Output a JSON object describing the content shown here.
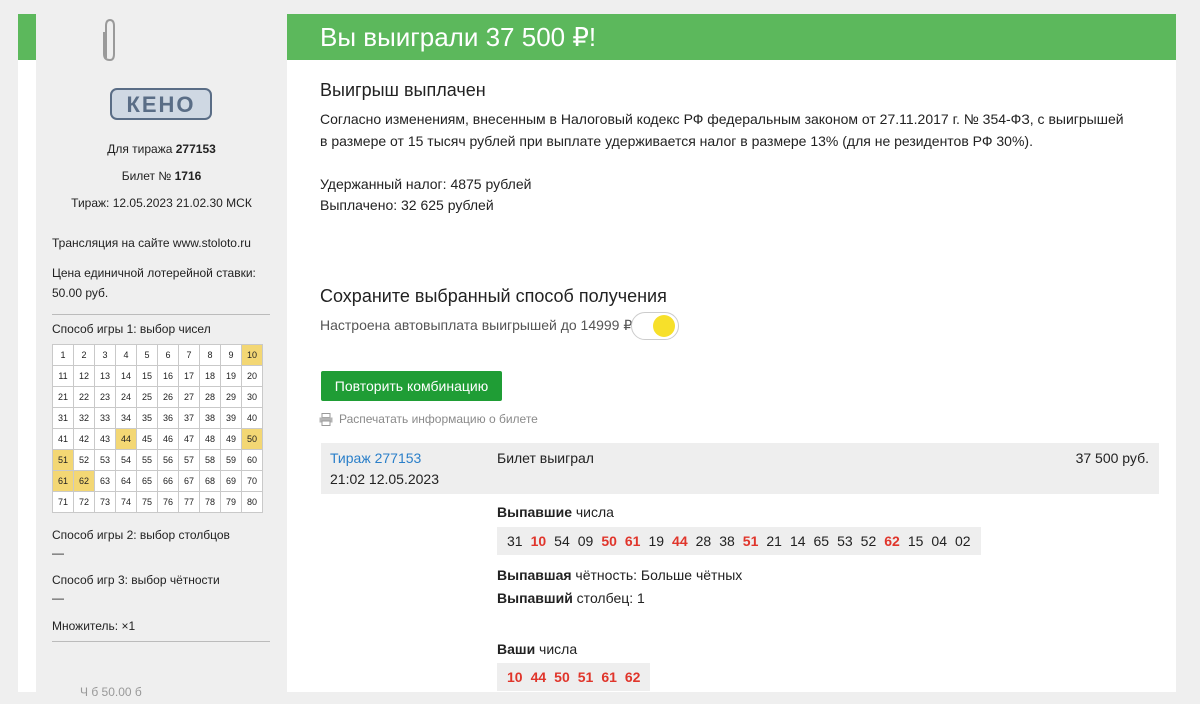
{
  "ticket": {
    "logo_text": "КЕНО",
    "draw_label": "Для тиража",
    "draw_number": "277153",
    "ticket_label": "Билет №",
    "ticket_number": "1716",
    "draw_datetime": "Тираж: 12.05.2023 21.02.30 МСК",
    "broadcast": "Трансляция на сайте www.stoloto.ru",
    "price_label": "Цена единичной лотерейной ставки:",
    "price_value": "50.00 руб.",
    "game1": "Способ игры 1: выбор чисел",
    "grid_numbers": [
      1,
      2,
      3,
      4,
      5,
      6,
      7,
      8,
      9,
      10,
      11,
      12,
      13,
      14,
      15,
      16,
      17,
      18,
      19,
      20,
      21,
      22,
      23,
      24,
      25,
      26,
      27,
      28,
      29,
      30,
      31,
      32,
      33,
      34,
      35,
      36,
      37,
      38,
      39,
      40,
      41,
      42,
      43,
      44,
      45,
      46,
      47,
      48,
      49,
      50,
      51,
      52,
      53,
      54,
      55,
      56,
      57,
      58,
      59,
      60,
      61,
      62,
      63,
      64,
      65,
      66,
      67,
      68,
      69,
      70,
      71,
      72,
      73,
      74,
      75,
      76,
      77,
      78,
      79,
      80
    ],
    "selected_numbers": [
      10,
      44,
      50,
      51,
      61,
      62
    ],
    "game2": "Способ игры 2: выбор столбцов",
    "game2_value": "—",
    "game3": "Способ игр 3: выбор чётности",
    "game3_value": "—",
    "multiplier": "Множитель: ×1",
    "bottom_cut": "Ч   б         50.00   б"
  },
  "banner": {
    "title": "Вы выиграли 37 500 ₽!",
    "color": "#5cb85c"
  },
  "payout": {
    "heading": "Выигрыш выплачен",
    "tax_text_1": "Согласно изменениям, внесенным в Налоговый кодекс РФ федеральным законом от 27.11.2017 г. № 354-ФЗ, с выигрышей",
    "tax_text_2": "в размере от 15 тысяч рублей при выплате удерживается налог в размере 13% (для не резидентов РФ 30%).",
    "tax_withheld": "Удержанный налог: 4875 рублей",
    "paid_out": "Выплачено: 32 625 рублей"
  },
  "receive": {
    "heading": "Сохраните выбранный способ получения",
    "autopay_label": "Настроена автовыплата выигрышей до 14999 ₽",
    "autopay_on": true
  },
  "actions": {
    "repeat_button": "Повторить комбинацию",
    "print_link": "Распечатать информацию о билете"
  },
  "result": {
    "draw_link": "Тираж 277153",
    "draw_time": "21:02 12.05.2023",
    "status": "Билет выиграл",
    "amount": "37 500 руб.",
    "drawn_bold": "Выпавшие",
    "drawn_rest": " числа",
    "drawn_numbers": [
      "31",
      "10",
      "54",
      "09",
      "50",
      "61",
      "19",
      "44",
      "28",
      "38",
      "51",
      "21",
      "14",
      "65",
      "53",
      "52",
      "62",
      "15",
      "04",
      "02"
    ],
    "hit_numbers": [
      "10",
      "50",
      "61",
      "44",
      "51",
      "62"
    ],
    "parity_bold": "Выпавшая",
    "parity_rest": " чётность: Больше чётных",
    "column_bold": "Выпавший",
    "column_rest": " столбец: 1",
    "your_bold": "Ваши",
    "your_rest": " числа",
    "your_numbers": [
      "10",
      "44",
      "50",
      "51",
      "61",
      "62"
    ],
    "hit_color": "#e0352b"
  }
}
